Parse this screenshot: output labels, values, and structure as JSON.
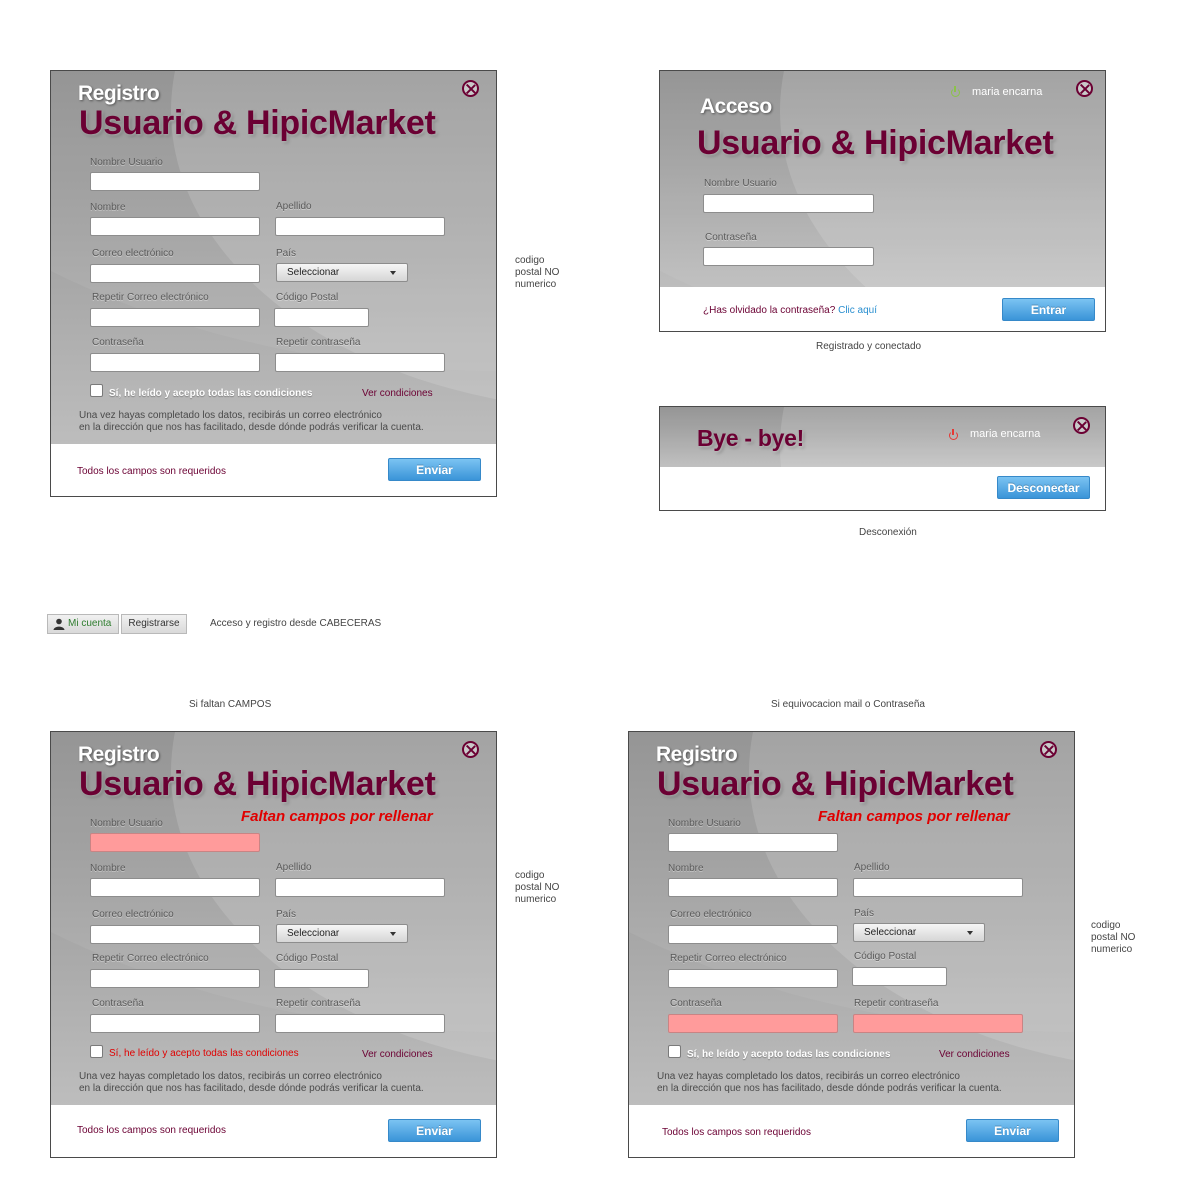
{
  "registro": {
    "small_title": "Registro",
    "big_title": "Usuario & HipicMarket",
    "labels": {
      "nombre_usuario": "Nombre Usuario",
      "nombre": "Nombre",
      "apellido": "Apellido",
      "correo": "Correo electrónico",
      "pais": "País",
      "repetir_correo": "Repetir Correo electrónico",
      "codigo_postal": "Código Postal",
      "contrasena": "Contraseña",
      "repetir_contrasena": "Repetir contraseña"
    },
    "select_value": "Seleccionar",
    "checkbox_text": "Sí, he leído y acepto todas las condiciones",
    "ver_condiciones": "Ver condiciones",
    "info_line1": "Una vez hayas completado los datos, recibirás un correo electrónico",
    "info_line2": "en la dirección que nos has facilitado, desde dónde podrás verificar la cuenta.",
    "requeridos": "Todos los campos son requeridos",
    "enviar": "Enviar",
    "error_message": "Faltan campos por rellenar"
  },
  "acceso": {
    "small_title": "Acceso",
    "big_title": "Usuario & HipicMarket",
    "user_name": "maria encarna",
    "label_usuario": "Nombre Usuario",
    "label_contrasena": "Contraseña",
    "forgot_text": "¿Has olvidado la contraseña?",
    "forgot_link": "Clic aquí",
    "entrar": "Entrar"
  },
  "bye": {
    "title": "Bye - bye!",
    "user_name": "maria encarna",
    "desconectar": "Desconectar"
  },
  "notes": {
    "codigo_postal": [
      "codigo",
      "postal NO",
      "numerico"
    ],
    "registrado": "Registrado y conectado",
    "desconexion": "Desconexión",
    "cabeceras": "Acceso y registro desde CABECERAS",
    "faltan_campos": "Si faltan CAMPOS",
    "equivocacion": "Si equivocacion mail o Contraseña"
  },
  "header_buttons": {
    "mi_cuenta": "Mi cuenta",
    "registrarse": "Registrarse"
  },
  "colors": {
    "brand": "#6b0033",
    "button_blue": "#3a94d8",
    "error_red": "#e00000",
    "error_field": "#ff9b9b",
    "power_on": "#8bc34a",
    "power_off": "#e53935"
  }
}
